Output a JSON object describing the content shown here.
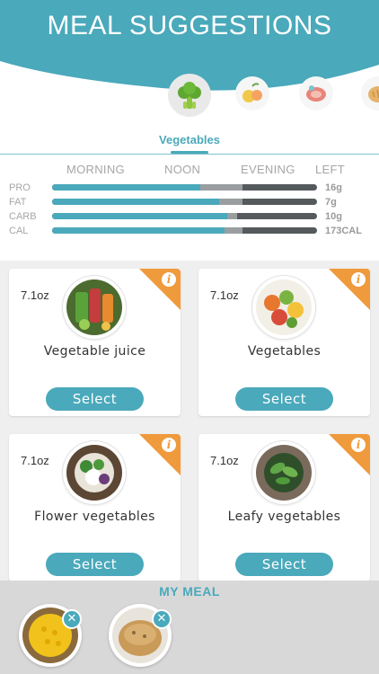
{
  "header": {
    "title": "MEAL SUGGESTIONS",
    "color": "#4aa9bb"
  },
  "categories": [
    {
      "icon": "broccoli-icon",
      "active": true
    },
    {
      "icon": "fruit-icon",
      "active": false
    },
    {
      "icon": "meat-icon",
      "active": false
    },
    {
      "icon": "bread-icon",
      "active": false
    }
  ],
  "active_category_label": "Vegetables",
  "nutrition": {
    "columns": [
      "MORNING",
      "NOON",
      "EVENING",
      "LEFT"
    ],
    "rows": [
      {
        "label": "PRO",
        "value": "16g",
        "consumed_fraction": 0.56,
        "planned_fraction": 0.72
      },
      {
        "label": "FAT",
        "value": "7g",
        "consumed_fraction": 0.63,
        "planned_fraction": 0.72
      },
      {
        "label": "CARB",
        "value": "10g",
        "consumed_fraction": 0.66,
        "planned_fraction": 0.7
      },
      {
        "label": "CAL",
        "value": "173CAL",
        "consumed_fraction": 0.65,
        "planned_fraction": 0.72
      }
    ],
    "colors": {
      "consumed": "#4aa9bb",
      "planned": "#9a9ea0",
      "remaining": "#555a5c"
    }
  },
  "suggestions": [
    {
      "weight": "7.1oz",
      "name": "Vegetable juice",
      "select_label": "Select",
      "image": "vegetable-juice-photo"
    },
    {
      "weight": "7.1oz",
      "name": "Vegetables",
      "select_label": "Select",
      "image": "vegetables-photo"
    },
    {
      "weight": "7.1oz",
      "name": "Flower vegetables",
      "select_label": "Select",
      "image": "flower-vegetables-photo"
    },
    {
      "weight": "7.1oz",
      "name": "Leafy vegetables",
      "select_label": "Select",
      "image": "leafy-vegetables-photo"
    }
  ],
  "info_badge": {
    "glyph": "i",
    "color": "#ef9a3c"
  },
  "my_meal": {
    "title": "MY MEAL",
    "remove_glyph": "✕",
    "items": [
      {
        "image": "corn-photo"
      },
      {
        "image": "bread-roll-photo"
      }
    ]
  }
}
